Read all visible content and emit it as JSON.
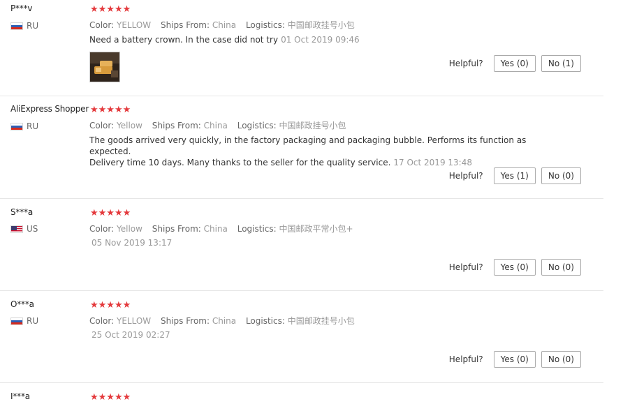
{
  "helpful_label": "Helpful?",
  "reviews": [
    {
      "user": "P***v",
      "country": "RU",
      "rating": "★★★★★",
      "color_key": "Color:",
      "color_val": "YELLOW",
      "ships_key": "Ships From:",
      "ships_val": "China",
      "logistics_key": "Logistics:",
      "logistics_val": "中国邮政挂号小包",
      "text": "Need a battery crown. In the case did not try",
      "date": "01 Oct 2019 09:46",
      "yes": "Yes (0)",
      "no": "No (1)"
    },
    {
      "user": "AliExpress Shopper",
      "country": "RU",
      "rating": "★★★★★",
      "color_key": "Color:",
      "color_val": "Yellow",
      "ships_key": "Ships From:",
      "ships_val": "China",
      "logistics_key": "Logistics:",
      "logistics_val": "中国邮政挂号小包",
      "text_line1": "The goods arrived very quickly, in the factory packaging and packaging bubble. Performs its function as expected.",
      "text_line2": "Delivery time 10 days. Many thanks to the seller for the quality service.",
      "date": "17 Oct 2019 13:48",
      "yes": "Yes (1)",
      "no": "No (0)"
    },
    {
      "user": "S***a",
      "country": "US",
      "rating": "★★★★★",
      "color_key": "Color:",
      "color_val": "Yellow",
      "ships_key": "Ships From:",
      "ships_val": "China",
      "logistics_key": "Logistics:",
      "logistics_val": "中国邮政平常小包+",
      "date": "05 Nov 2019 13:17",
      "yes": "Yes (0)",
      "no": "No (0)"
    },
    {
      "user": "O***a",
      "country": "RU",
      "rating": "★★★★★",
      "color_key": "Color:",
      "color_val": "YELLOW",
      "ships_key": "Ships From:",
      "ships_val": "China",
      "logistics_key": "Logistics:",
      "logistics_val": "中国邮政挂号小包",
      "date": "25 Oct 2019 02:27",
      "yes": "Yes (0)",
      "no": "No (0)"
    },
    {
      "user": "I***a",
      "rating": "★★★★★"
    }
  ],
  "colors": {
    "star": "#e4393c",
    "muted": "#999999",
    "divider": "#e6e6e6"
  },
  "icons": [
    "flag-ru-icon",
    "flag-us-icon",
    "star-icon"
  ]
}
